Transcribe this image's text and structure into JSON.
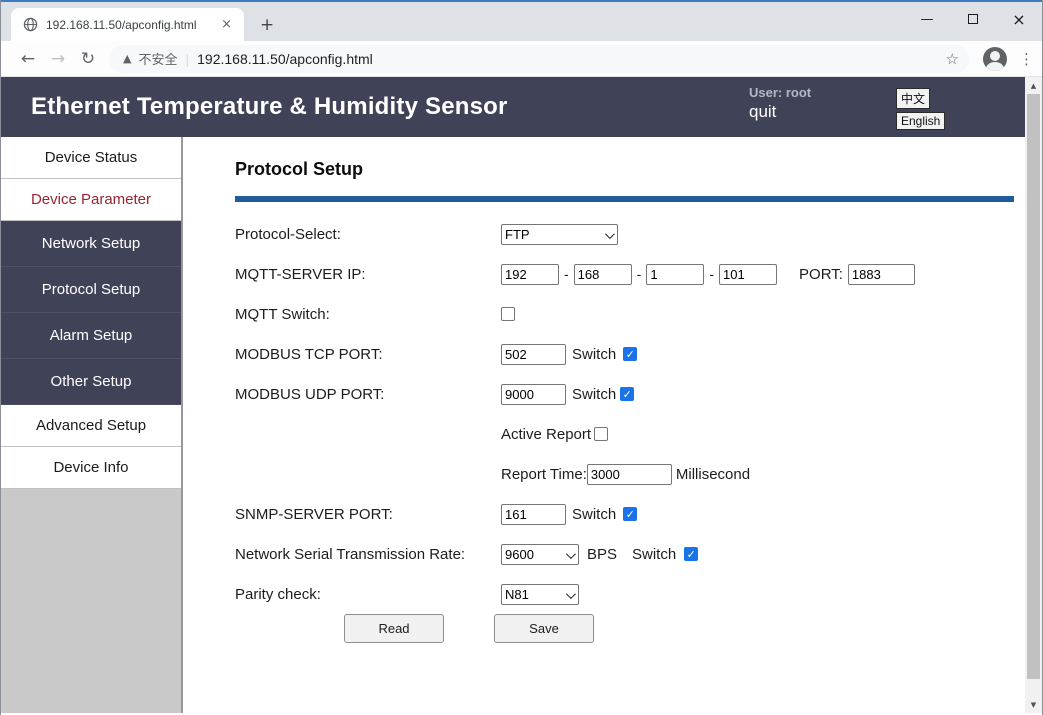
{
  "browser": {
    "tab_title": "192.168.11.50/apconfig.html",
    "address": {
      "security_text": "不安全",
      "separator": "|",
      "url": "192.168.11.50/apconfig.html"
    }
  },
  "icons": {
    "tab_close": "×",
    "new_tab": "+",
    "minimize": "—",
    "close": "×",
    "back": "←",
    "forward": "→",
    "refresh": "↻",
    "warning": "▲",
    "star": "☆",
    "menu": "⋮",
    "scroll_up": "▲",
    "scroll_down": "▼"
  },
  "site": {
    "title": "Ethernet Temperature & Humidity Sensor",
    "user_label": "User: root",
    "quit_label": "quit",
    "lang_zh": "中文",
    "lang_en": "English"
  },
  "sidebar": {
    "items": [
      {
        "label": "Device Status",
        "variant": "light",
        "active": false
      },
      {
        "label": "Device Parameter",
        "variant": "light",
        "active": true
      },
      {
        "label": "Network Setup",
        "variant": "dark",
        "active": false
      },
      {
        "label": "Protocol Setup",
        "variant": "dark",
        "active": false
      },
      {
        "label": "Alarm Setup",
        "variant": "dark",
        "active": false
      },
      {
        "label": "Other Setup",
        "variant": "dark",
        "active": false
      },
      {
        "label": "Advanced Setup",
        "variant": "light",
        "active": false
      },
      {
        "label": "Device Info",
        "variant": "light",
        "active": false
      }
    ]
  },
  "page": {
    "title": "Protocol Setup",
    "form": {
      "protocol_select": {
        "label": "Protocol-Select:",
        "value": "FTP"
      },
      "mqtt_ip": {
        "label": "MQTT-SERVER IP:",
        "octets": [
          "192",
          "168",
          "1",
          "101"
        ],
        "separator": "-",
        "port_label": "PORT:",
        "port_value": "1883"
      },
      "mqtt_switch": {
        "label": "MQTT Switch:",
        "checked": false
      },
      "modbus_tcp": {
        "label": "MODBUS TCP PORT:",
        "value": "502",
        "switch_label": "Switch",
        "switch_checked": true
      },
      "modbus_udp": {
        "label": "MODBUS UDP PORT:",
        "value": "9000",
        "switch_label": "Switch",
        "switch_checked": true
      },
      "active_report": {
        "label": "Active Report",
        "checked": false
      },
      "report_time": {
        "label": "Report Time:",
        "value": "3000",
        "unit": "Millisecond"
      },
      "snmp_port": {
        "label": "SNMP-SERVER PORT:",
        "value": "161",
        "switch_label": "Switch",
        "switch_checked": true
      },
      "serial_rate": {
        "label": "Network Serial Transmission Rate:",
        "value": "9600",
        "unit": "BPS",
        "switch_label": "Switch",
        "switch_checked": true
      },
      "parity": {
        "label": "Parity check:",
        "value": "N81"
      },
      "buttons": {
        "read": "Read",
        "save": "Save"
      }
    }
  },
  "colors": {
    "header_bg": "#404358",
    "accent_rule": "#1e5c9b",
    "active_item_text": "#9a2433",
    "checkbox_checked": "#1a73e8",
    "tabstrip_bg": "#dee1e6"
  }
}
